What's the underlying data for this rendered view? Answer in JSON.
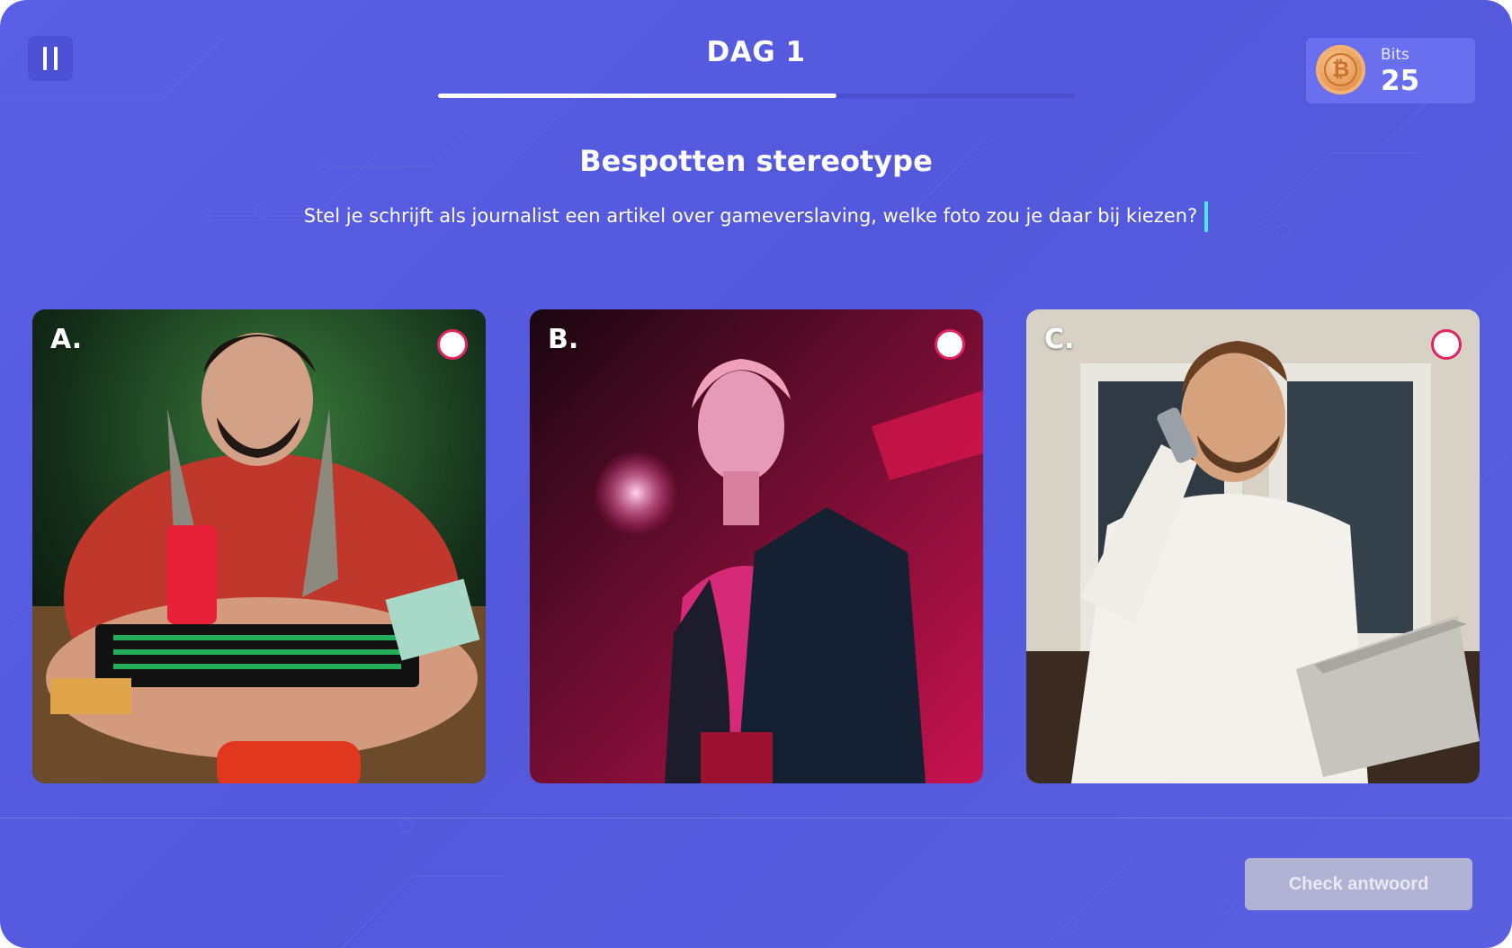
{
  "header": {
    "day_title": "DAG 1",
    "progress": 0.625,
    "bits": {
      "label": "Bits",
      "value": "25",
      "icon": "bitcoin-icon"
    }
  },
  "question": {
    "title": "Bespotten stereotype",
    "text": "Stel je schrijft als journalist een artikel over gameverslaving, welke foto zou je daar bij kiezen?"
  },
  "options": [
    {
      "letter": "A.",
      "selected": false
    },
    {
      "letter": "B.",
      "selected": false
    },
    {
      "letter": "C.",
      "selected": false
    }
  ],
  "footer": {
    "check_label": "Check antwoord",
    "check_enabled": false
  },
  "colors": {
    "background": "#5358dc",
    "accent_caret": "#4ee6ff",
    "radio_ring": "#e0245e",
    "button_disabled": "#b2b3d4"
  }
}
